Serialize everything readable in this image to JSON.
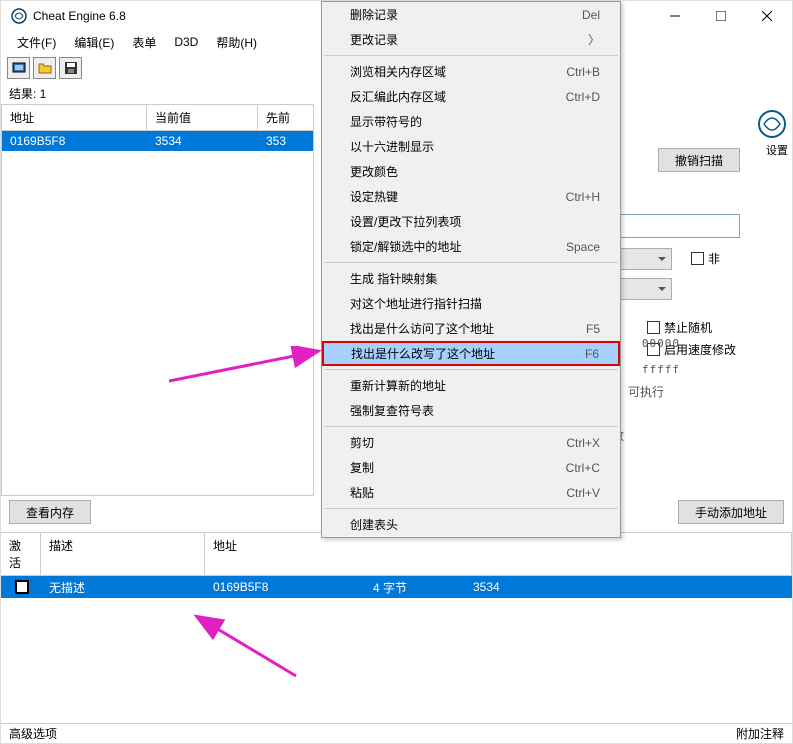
{
  "title": "Cheat Engine 6.8",
  "menu": {
    "file": "文件(F)",
    "edit": "编辑(E)",
    "table": "表单",
    "d3d": "D3D",
    "help": "帮助(H)"
  },
  "results_label": "结果: 1",
  "columns": {
    "address": "地址",
    "value": "当前值",
    "previous": "先前"
  },
  "row": {
    "address": "0169B5F8",
    "value": "3534",
    "previous": "353"
  },
  "side": {
    "settings": "设置",
    "undo": "撤销扫描",
    "fei": "非",
    "no_random": "禁止随机",
    "speed_mod": "启用速度修改",
    "hex0": "00000",
    "hexf": "fffff",
    "exec": "可执行",
    "digits": "数"
  },
  "midbar": {
    "view_memory": "查看内存",
    "add_manual": "手动添加地址"
  },
  "lowcols": {
    "active": "激活",
    "desc": "描述",
    "address": "地址"
  },
  "lowrow": {
    "desc": "无描述",
    "address": "0169B5F8",
    "type": "4 字节",
    "value": "3534"
  },
  "status": {
    "adv": "高级选项",
    "notes": "附加注释"
  },
  "ctx": {
    "delete": "删除记录",
    "delete_k": "Del",
    "change": "更改记录",
    "browse": "浏览相关内存区域",
    "browse_k": "Ctrl+B",
    "disasm": "反汇编此内存区域",
    "disasm_k": "Ctrl+D",
    "signed": "显示带符号的",
    "hex": "以十六进制显示",
    "color": "更改颜色",
    "hotkey": "设定热键",
    "hotkey_k": "Ctrl+H",
    "dropdown": "设置/更改下拉列表项",
    "lock": "锁定/解锁选中的地址",
    "lock_k": "Space",
    "pointermap": "生成 指针映射集",
    "pointerscan": "对这个地址进行指针扫描",
    "access": "找出是什么访问了这个地址",
    "access_k": "F5",
    "write": "找出是什么改写了这个地址",
    "write_k": "F6",
    "recalc": "重新计算新的地址",
    "symbols": "强制复查符号表",
    "cut": "剪切",
    "cut_k": "Ctrl+X",
    "copy": "复制",
    "copy_k": "Ctrl+C",
    "paste": "粘贴",
    "paste_k": "Ctrl+V",
    "header": "创建表头"
  }
}
